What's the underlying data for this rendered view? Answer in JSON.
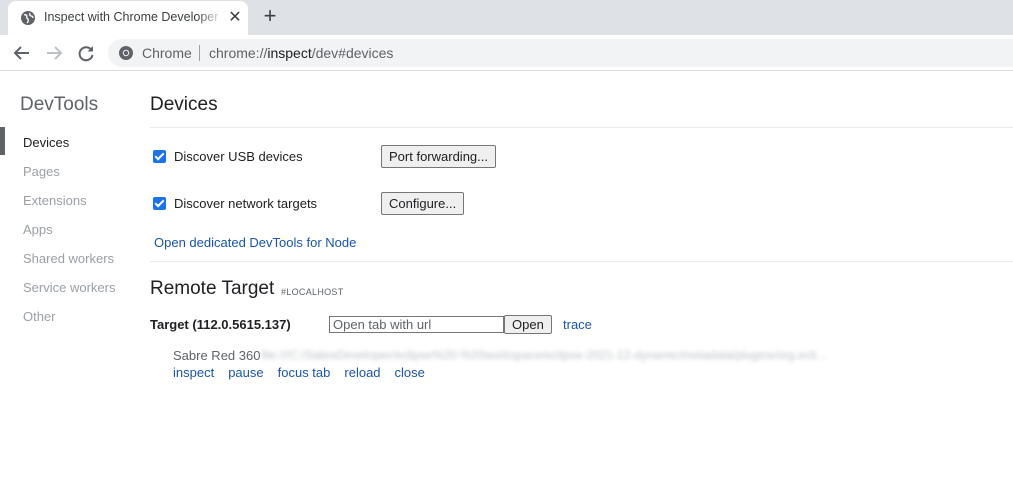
{
  "browser": {
    "tab_title": "Inspect with Chrome Developer Tools",
    "tab_close": "✕",
    "new_tab": "+",
    "site_chip": "Chrome",
    "url_scheme": "chrome://",
    "url_host": "inspect",
    "url_path": "/dev#devices"
  },
  "sidebar": {
    "title": "DevTools",
    "items": [
      {
        "label": "Devices",
        "active": true
      },
      {
        "label": "Pages",
        "active": false
      },
      {
        "label": "Extensions",
        "active": false
      },
      {
        "label": "Apps",
        "active": false
      },
      {
        "label": "Shared workers",
        "active": false
      },
      {
        "label": "Service workers",
        "active": false
      },
      {
        "label": "Other",
        "active": false
      }
    ]
  },
  "main": {
    "title": "Devices",
    "discover_usb": {
      "label": "Discover USB devices",
      "checked": true
    },
    "port_forwarding_button": "Port forwarding...",
    "discover_network": {
      "label": "Discover network targets",
      "checked": true
    },
    "configure_button": "Configure...",
    "node_link": "Open dedicated DevTools for Node",
    "remote_title": "Remote Target",
    "remote_tag": "#LOCALHOST",
    "target": {
      "label": "Target (112.0.5615.137)",
      "input_placeholder": "Open tab with url",
      "open_button": "Open",
      "trace_link": "trace"
    },
    "entry": {
      "name": "Sabre Red 360",
      "url": "file:///C:/SabreDeveloper/eclipse%20-%20workspace/eclipse-2021-12-dynamic/metadata/plugins/org.ecli...",
      "actions": [
        "inspect",
        "pause",
        "focus tab",
        "reload",
        "close"
      ]
    }
  },
  "colors": {
    "accent": "#1a73e8",
    "link": "#1a55a8",
    "tabstrip": "#dee1e6"
  }
}
